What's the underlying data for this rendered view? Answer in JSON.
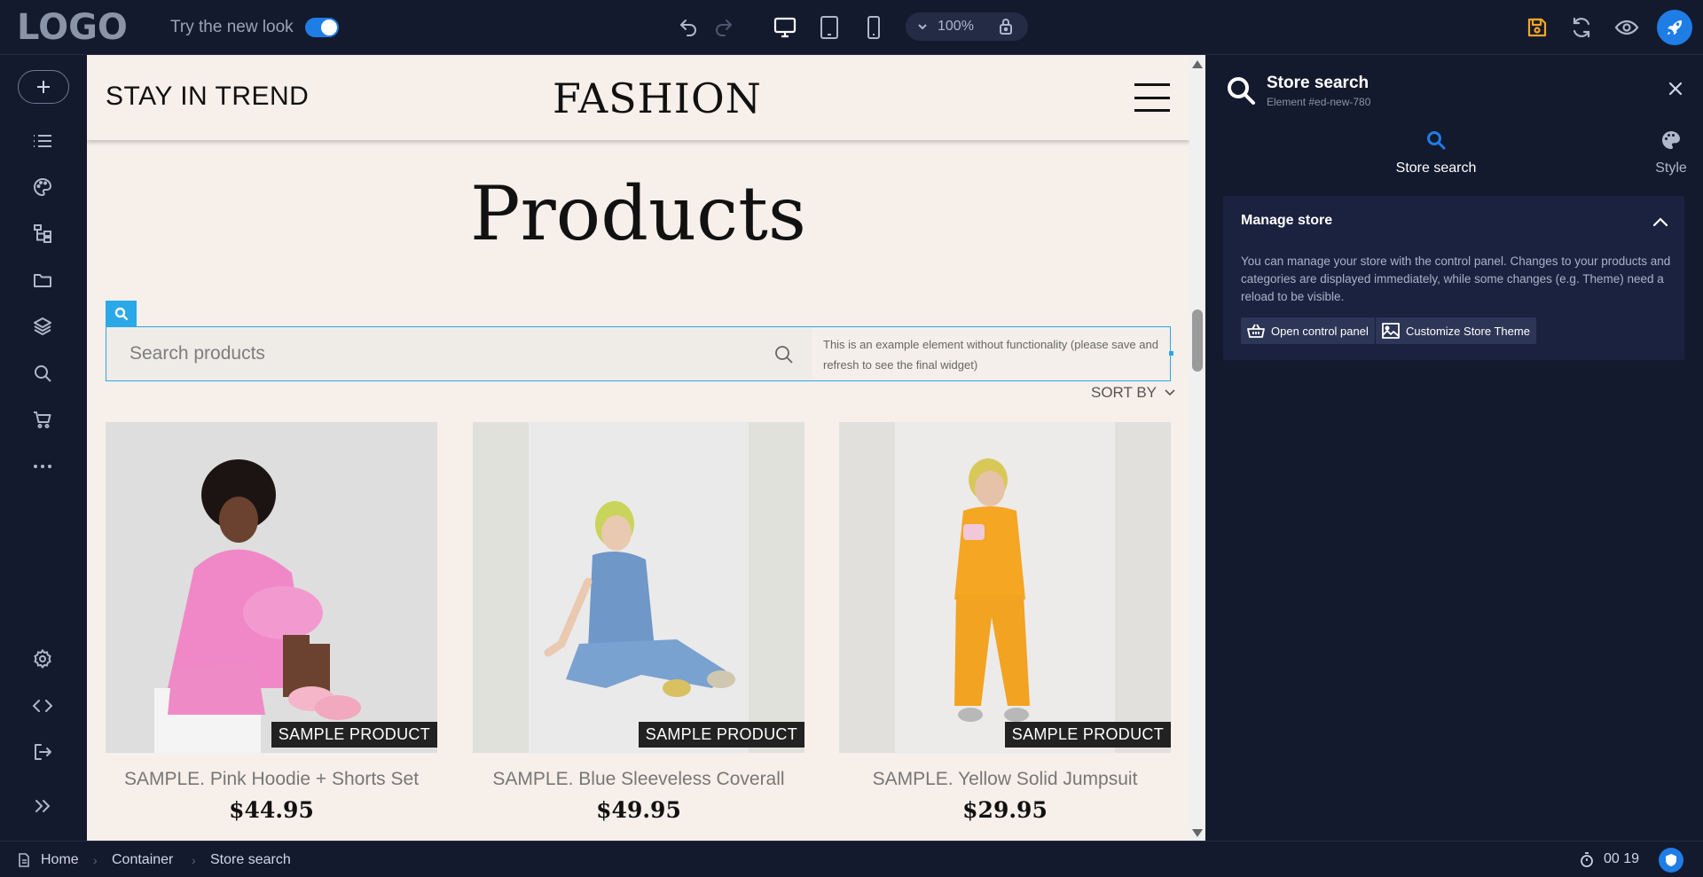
{
  "topbar": {
    "logo": "LOGO",
    "new_look_label": "Try the new look",
    "new_look_enabled": true,
    "zoom_level": "100%"
  },
  "canvas": {
    "header": {
      "tagline": "STAY IN TREND",
      "brand": "FASHION"
    },
    "page_title": "Products",
    "search": {
      "placeholder": "Search products",
      "note": "This is an example element without functionality (please save and refresh to see the final widget)"
    },
    "sort_label": "SORT BY",
    "products": [
      {
        "name": "SAMPLE. Pink Hoodie + Shorts Set",
        "price": "$44.95",
        "badge": "SAMPLE PRODUCT"
      },
      {
        "name": "SAMPLE. Blue Sleeveless Coverall",
        "price": "$49.95",
        "badge": "SAMPLE PRODUCT"
      },
      {
        "name": "SAMPLE. Yellow Solid Jumpsuit",
        "price": "$29.95",
        "badge": "SAMPLE PRODUCT"
      }
    ]
  },
  "panel": {
    "title": "Store search",
    "subtitle": "Element #ed-new-780",
    "tabs": [
      {
        "label": "Store search",
        "active": true
      },
      {
        "label": "Style",
        "active": false
      }
    ],
    "section": {
      "title": "Manage store",
      "description": "You can manage your store with the control panel. Changes to your products and categories are displayed immediately, while some changes (e.g. Theme) need a reload to be visible.",
      "buttons": [
        {
          "label": "Open control panel",
          "icon": "basket-icon"
        },
        {
          "label": "Customize Store Theme",
          "icon": "image-icon"
        }
      ]
    }
  },
  "bottombar": {
    "breadcrumb": [
      "Home",
      "Container",
      "Store search"
    ],
    "timer": "00 19"
  },
  "colors": {
    "accent": "#1f7de6",
    "selection": "#2aa8e8",
    "save_icon": "#f5a623",
    "app_bg": "#141a2e",
    "canvas_bg": "#f7efea"
  }
}
